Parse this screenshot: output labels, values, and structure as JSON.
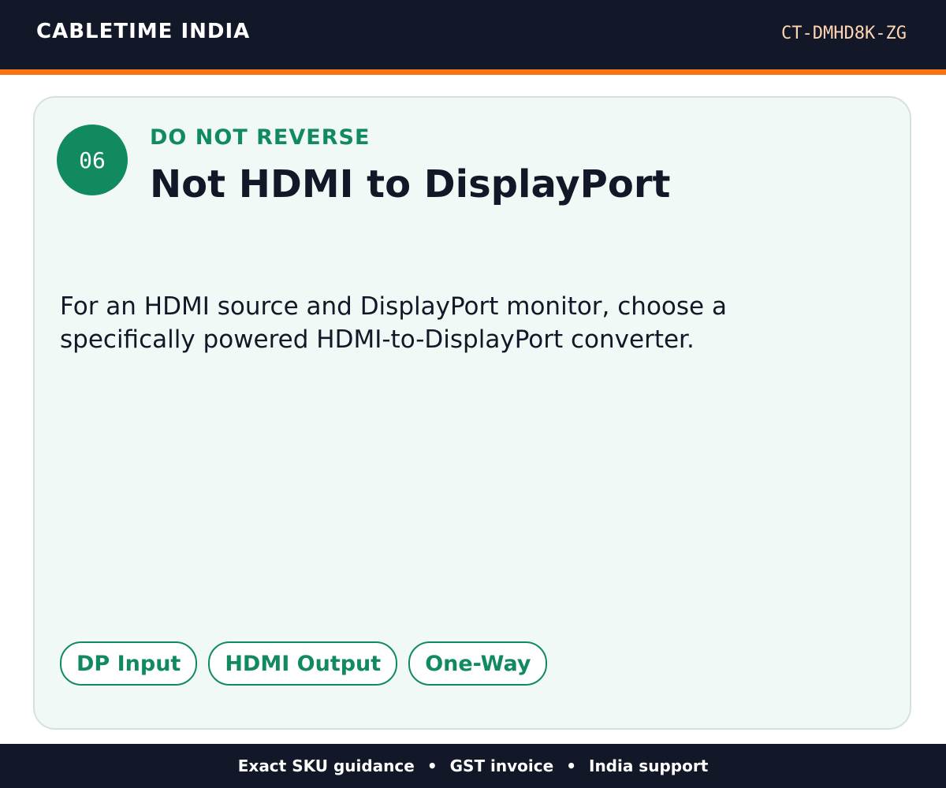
{
  "header": {
    "brand": "CABLETIME INDIA",
    "sku": "CT-DMHD8K-ZG"
  },
  "card": {
    "step": "06",
    "eyebrow": "DO NOT REVERSE",
    "title": "Not HDMI to DisplayPort",
    "body": "For an HDMI source and DisplayPort monitor, choose a specifically powered HDMI-to-DisplayPort converter.",
    "tags": [
      "DP Input",
      "HDMI Output",
      "One-Way"
    ]
  },
  "footer": {
    "items": [
      "Exact SKU guidance",
      "GST invoice",
      "India support"
    ],
    "separator": "•"
  },
  "colors": {
    "header_bg": "#121828",
    "accent_orange": "#f97316",
    "brand_green": "#118a5f",
    "card_bg": "#f0f9f5"
  }
}
